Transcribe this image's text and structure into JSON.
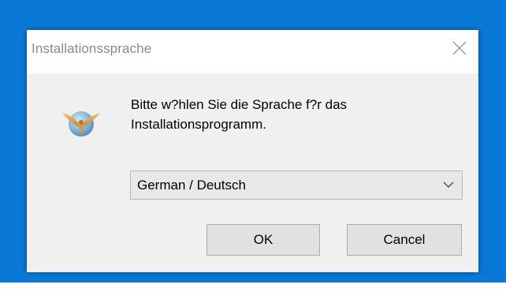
{
  "dialog": {
    "title": "Installationssprache",
    "message_line1": "Bitte w?hlen Sie die Sprache f?r das",
    "message_line2": "Installationsprogramm.",
    "icon": "setup-globe-eagle-icon"
  },
  "language_select": {
    "selected": "German / Deutsch"
  },
  "buttons": {
    "ok_label": "OK",
    "cancel_label": "Cancel"
  },
  "colors": {
    "desktop_background": "#0a78d7",
    "dialog_background": "#f0f0f0",
    "titlebar_background": "#ffffff",
    "title_text": "#8a8a8a"
  }
}
